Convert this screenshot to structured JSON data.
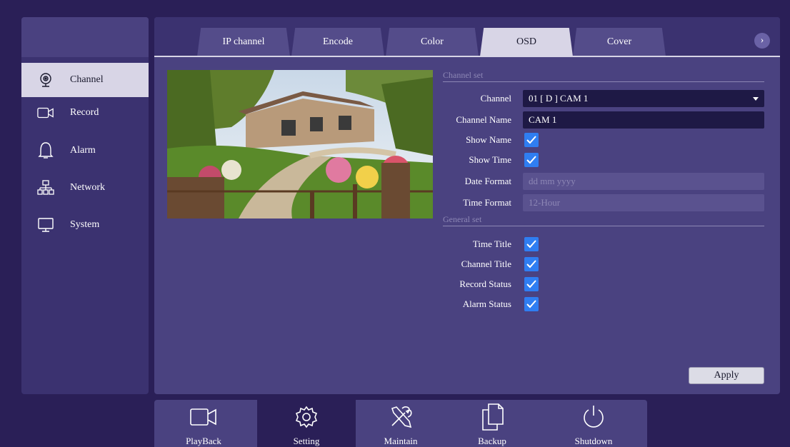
{
  "sidebar": {
    "items": [
      {
        "label": "Channel",
        "icon": "webcam-icon",
        "active": true
      },
      {
        "label": "Record",
        "icon": "video-camera-icon",
        "active": false
      },
      {
        "label": "Alarm",
        "icon": "bell-icon",
        "active": false
      },
      {
        "label": "Network",
        "icon": "network-icon",
        "active": false
      },
      {
        "label": "System",
        "icon": "monitor-icon",
        "active": false
      }
    ]
  },
  "tabs": [
    {
      "label": "IP channel",
      "active": false
    },
    {
      "label": "Encode",
      "active": false
    },
    {
      "label": "Color",
      "active": false
    },
    {
      "label": "OSD",
      "active": true
    },
    {
      "label": "Cover",
      "active": false
    }
  ],
  "osd": {
    "channel_set_title": "Channel set",
    "channel_label": "Channel",
    "channel_value": "01 [ D ] CAM 1",
    "channel_name_label": "Channel Name",
    "channel_name_value": "CAM 1",
    "show_name_label": "Show Name",
    "show_name_checked": true,
    "show_time_label": "Show Time",
    "show_time_checked": true,
    "date_format_label": "Date Format",
    "date_format_value": "dd mm yyyy",
    "time_format_label": "Time Format",
    "time_format_value": "12-Hour",
    "general_set_title": "General set",
    "time_title_label": "Time Title",
    "time_title_checked": true,
    "channel_title_label": "Channel Title",
    "channel_title_checked": true,
    "record_status_label": "Record Status",
    "record_status_checked": true,
    "alarm_status_label": "Alarm Status",
    "alarm_status_checked": true,
    "apply_label": "Apply"
  },
  "bottom_nav": [
    {
      "label": "PlayBack",
      "icon": "video-camera-icon",
      "active": false
    },
    {
      "label": "Setting",
      "icon": "gear-icon",
      "active": true
    },
    {
      "label": "Maintain",
      "icon": "tools-icon",
      "active": false
    },
    {
      "label": "Backup",
      "icon": "copy-icon",
      "active": false
    },
    {
      "label": "Shutdown",
      "icon": "power-icon",
      "active": false
    }
  ],
  "colors": {
    "background": "#2a1f57",
    "panel": "#4a4280",
    "accent_check": "#2f7ef2",
    "active_tab": "#d8d5e6"
  }
}
